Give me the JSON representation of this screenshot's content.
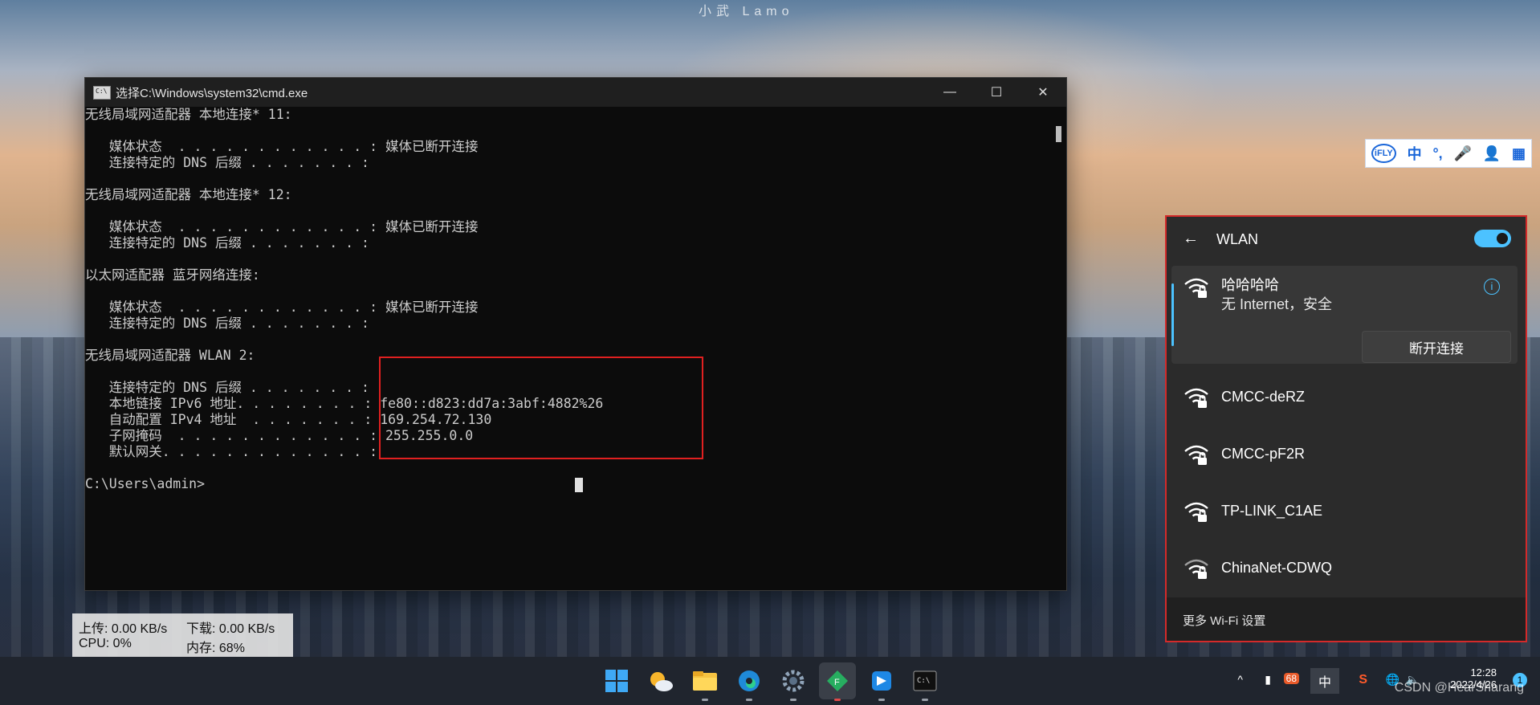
{
  "watermark_top": "小武 Lamo",
  "cmd": {
    "title": "选择C:\\Windows\\system32\\cmd.exe",
    "minimize": "—",
    "maximize": "☐",
    "close": "✕",
    "lines": [
      "无线局域网适配器 本地连接* 11:",
      "",
      "   媒体状态  . . . . . . . . . . . . : 媒体已断开连接",
      "   连接特定的 DNS 后缀 . . . . . . . :",
      "",
      "无线局域网适配器 本地连接* 12:",
      "",
      "   媒体状态  . . . . . . . . . . . . : 媒体已断开连接",
      "   连接特定的 DNS 后缀 . . . . . . . :",
      "",
      "以太网适配器 蓝牙网络连接:",
      "",
      "   媒体状态  . . . . . . . . . . . . : 媒体已断开连接",
      "   连接特定的 DNS 后缀 . . . . . . . :",
      "",
      "无线局域网适配器 WLAN 2:",
      "",
      "   连接特定的 DNS 后缀 . . . . . . . :",
      "   本地链接 IPv6 地址. . . . . . . . : fe80::d823:dd7a:3abf:4882%26",
      "   自动配置 IPv4 地址  . . . . . . . : 169.254.72.130",
      "   子网掩码  . . . . . . . . . . . . : 255.255.0.0",
      "   默认网关. . . . . . . . . . . . . :",
      "",
      "C:\\Users\\admin>"
    ]
  },
  "netspeed": {
    "upload": "上传: 0.00 KB/s",
    "download": "下载: 0.00 KB/s",
    "cpu": "CPU: 0%",
    "memory": "内存: 68%"
  },
  "ifly": {
    "items": [
      "iFLY",
      "中",
      "°,",
      "🎤",
      "👤",
      "▦"
    ]
  },
  "wlan": {
    "title": "WLAN",
    "back_icon": "←",
    "toggle_on": true,
    "connected": {
      "name": "哈哈哈哈",
      "status": "无 Internet，安全",
      "disconnect_label": "断开连接",
      "info_icon": "i"
    },
    "networks": [
      {
        "name": "CMCC-deRZ"
      },
      {
        "name": "CMCC-pF2R"
      },
      {
        "name": "TP-LINK_C1AE"
      },
      {
        "name": "ChinaNet-CDWQ"
      }
    ],
    "more_settings": "更多 Wi-Fi 设置"
  },
  "taskbar": {
    "apps": [
      "windows-start",
      "weather",
      "file-explorer",
      "edge",
      "settings",
      "app-green",
      "app-blue",
      "terminal"
    ],
    "tray": {
      "chevron": "^",
      "badge": "68",
      "ime": "中",
      "ime_s": "S",
      "time": "12:28",
      "date": "2022/4/26",
      "notifications": "1"
    }
  },
  "watermark_bottom": "CSDN @HearSharang"
}
